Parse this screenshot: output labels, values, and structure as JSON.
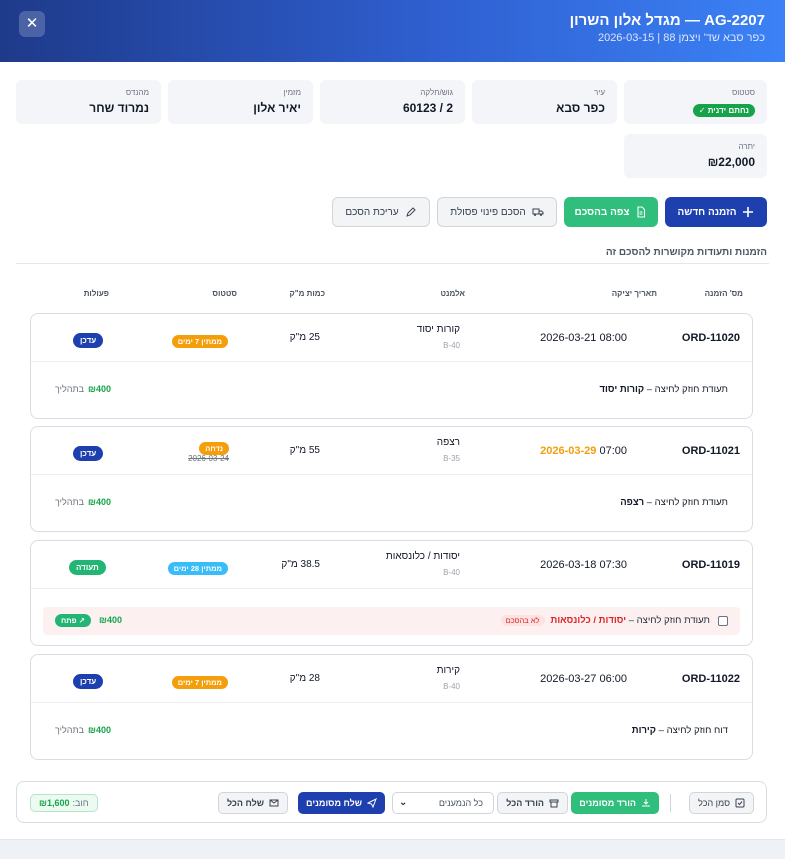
{
  "header": {
    "title": "AG-2207 — מגדל אלון השרון",
    "subtitle": "כפר סבא שד' ויצמן 88 | 2026-03-15",
    "close_label": "✕"
  },
  "info": {
    "status_label": "סטטוס",
    "status_value": "נחתם ידנית ✓",
    "city_label": "עיר",
    "city_value": "כפר סבא",
    "block_label": "גוש/חלקה",
    "block_value": "60123 / 2",
    "orderer_label": "מזמין",
    "orderer_value": "יאיר אלון",
    "engineer_label": "מהנדס",
    "engineer_value": "נמרוד שחר",
    "balance_label": "יתרה",
    "balance_value": "₪22,000"
  },
  "actions": {
    "new_order": "הזמנה חדשה",
    "view_agreement": "צפה בהסכם",
    "waste_agreement": "הסכם פינוי פסולת",
    "edit_agreement": "עריכת הסכם"
  },
  "section_title": "הזמנות ותעודות מקושרות להסכם זה",
  "table_headers": {
    "order_no": "מס' הזמנה",
    "created": "תאריך יציקה",
    "element": "אלמנט",
    "qty": "כמות מ\"ק",
    "status": "סטטוס",
    "actions": "פעולות"
  },
  "orders": [
    {
      "no": "ORD-11020",
      "date": "2026-03-21",
      "time": "08:00",
      "element": "קורות יסוד",
      "grade": "B-40",
      "qty": "25 מ\"ק",
      "status": "ממתין 7 ימים",
      "action": "עדכן",
      "cert_prefix": "תעודת חוזק לחיצה – ",
      "cert_element": "קורות יסוד",
      "amount": "₪400",
      "amount_status": "בתהליך"
    },
    {
      "no": "ORD-11021",
      "date": "2026-03-29",
      "time": "07:00",
      "element": "רצפה",
      "grade": "B-35",
      "qty": "55 מ\"ק",
      "status": "נדחה",
      "old_date": "2026-03-24",
      "action": "עדכן",
      "cert_prefix": "תעודת חוזק לחיצה – ",
      "cert_element": "רצפה",
      "amount": "₪400",
      "amount_status": "בתהליך"
    },
    {
      "no": "ORD-11019",
      "date": "2026-03-18",
      "time": "07:30",
      "element": "יסודות / כלונסאות",
      "grade": "B-40",
      "qty": "38.5 מ\"ק",
      "status": "ממתין 28 ימים",
      "action": "תעודה",
      "cert_prefix": "תעודת חוזק לחיצה – ",
      "cert_element": "יסודות / כלונסאות",
      "cert_tag": "לא בהסכם",
      "amount": "₪400",
      "open_label": "פתח ↗"
    },
    {
      "no": "ORD-11022",
      "date": "2026-03-27",
      "time": "06:00",
      "element": "קירות",
      "grade": "B-40",
      "qty": "28 מ\"ק",
      "status": "ממתין 7 ימים",
      "action": "עדכן",
      "cert_prefix": "דוח חוזק לחיצה – ",
      "cert_element": "קירות",
      "amount": "₪400",
      "amount_status": "בתהליך"
    }
  ],
  "footer": {
    "select_all": "סמן הכל",
    "download_selected": "הורד מסומנים",
    "download_all": "הורד הכל",
    "recipients": "כל הנמענים",
    "send_selected": "שלח מסומנים",
    "send_all": "שלח הכל",
    "debt_label": "חוב:",
    "debt_value": "₪1,600"
  },
  "colors": {
    "header_start": "#1e3a8a",
    "header_end": "#3b82f6",
    "primary": "#1e40af",
    "success": "#2fbe7b",
    "warning": "#f59e0b",
    "info": "#38bdf8",
    "danger": "#dc2626"
  }
}
